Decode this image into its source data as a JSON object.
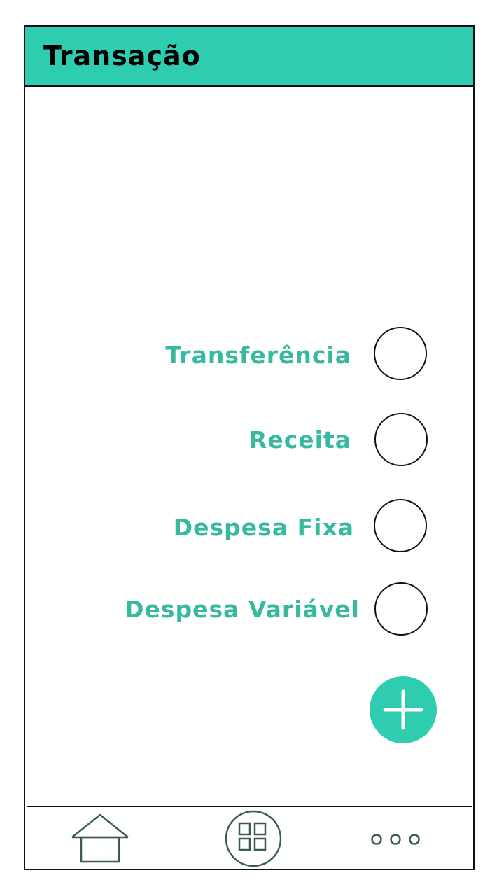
{
  "header": {
    "title": "Transação"
  },
  "options": [
    {
      "label": "Transferência"
    },
    {
      "label": "Receita"
    },
    {
      "label": "Despesa Fixa"
    },
    {
      "label": "Despesa Variável"
    }
  ],
  "fab": {
    "icon": "plus-icon"
  },
  "bottom_nav": {
    "items": [
      {
        "icon": "home-icon"
      },
      {
        "icon": "grid-icon"
      },
      {
        "icon": "more-dots-icon"
      }
    ]
  },
  "colors": {
    "accent": "#2fcdb0",
    "label": "#37b99f",
    "icon": "#3d5a55",
    "border": "#111111"
  }
}
